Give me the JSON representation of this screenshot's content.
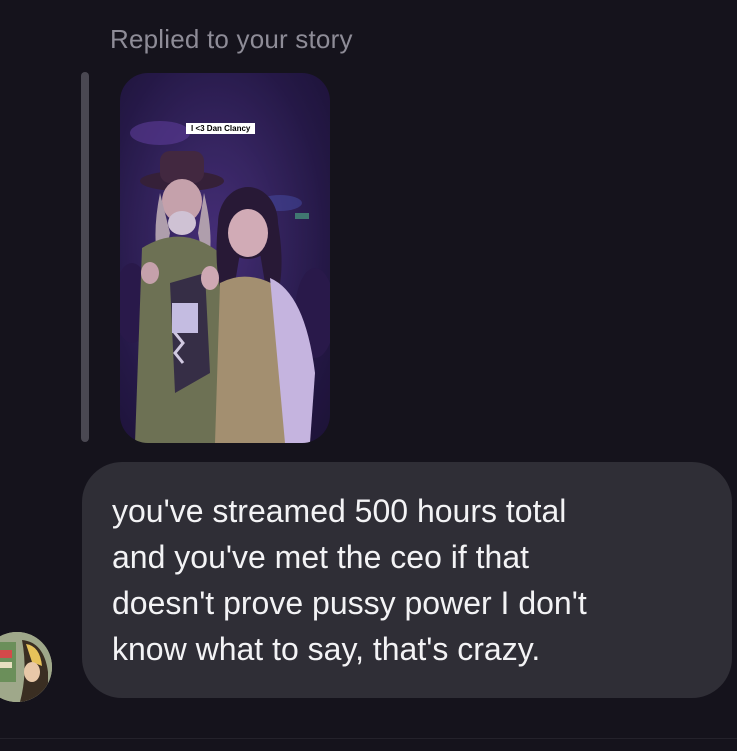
{
  "reply": {
    "label": "Replied to your story"
  },
  "story": {
    "caption": "I <3 Dan Clancy"
  },
  "message": {
    "text": "you've streamed 500 hours total\nand you've met the ceo if that\ndoesn't prove pussy power I don't\nknow what to say, that's crazy."
  },
  "avatar": {
    "icon": "user-avatar"
  },
  "colors": {
    "background": "#15131c",
    "bubble": "#2f2e36",
    "label": "#8e8c97",
    "text": "#f3f3f5"
  }
}
